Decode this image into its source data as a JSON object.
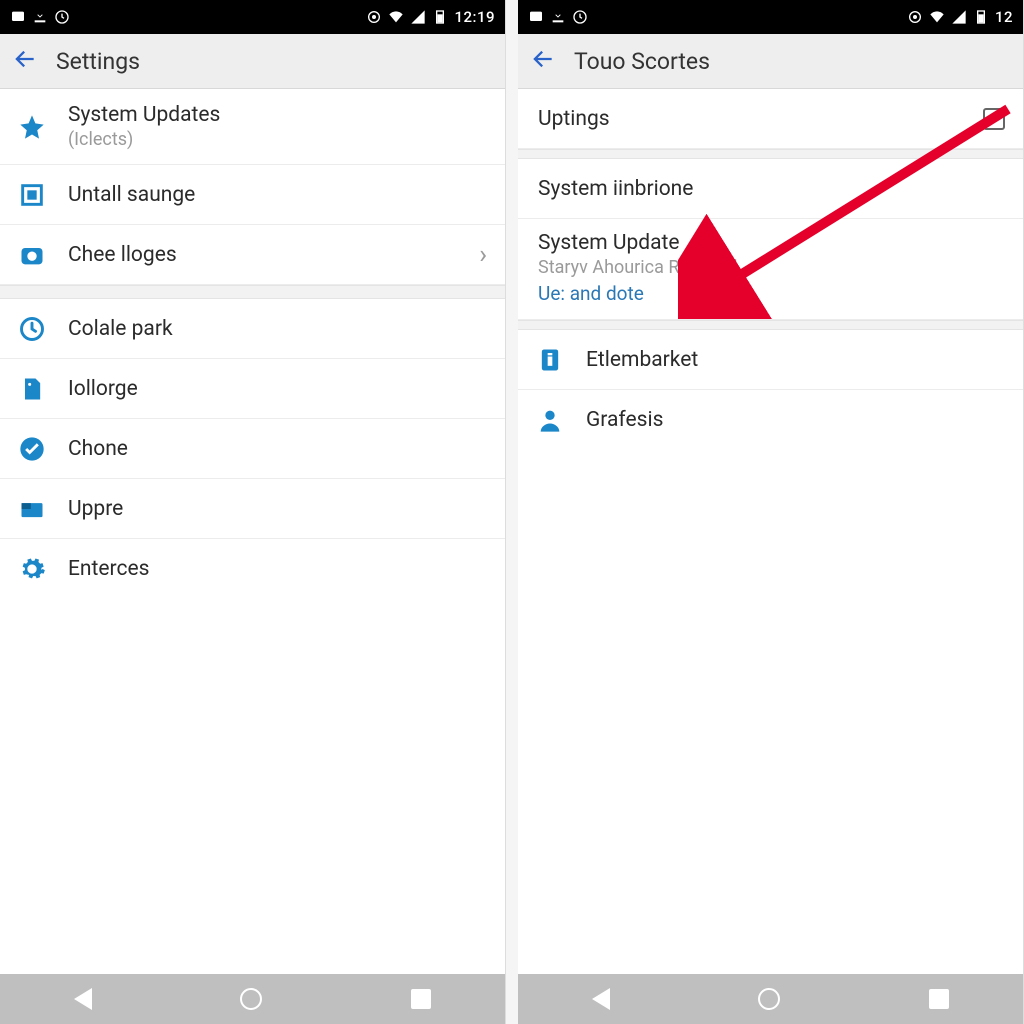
{
  "status": {
    "time": "12:19",
    "time_right": "12"
  },
  "left": {
    "title": "Settings",
    "rows": [
      {
        "icon": "star",
        "label": "System Updates",
        "sub": "(Iclects)"
      },
      {
        "icon": "square",
        "label": "Untall saunge"
      },
      {
        "icon": "camera",
        "label": "Chee lloges",
        "chevron": true
      },
      {
        "gap": true
      },
      {
        "icon": "clock",
        "label": "Colale park"
      },
      {
        "icon": "storage",
        "label": "Iollorge"
      },
      {
        "icon": "check",
        "label": "Chone"
      },
      {
        "icon": "card",
        "label": "Uppre"
      },
      {
        "icon": "gear",
        "label": "Enterces",
        "noBorder": true
      }
    ]
  },
  "right": {
    "title": "Touo Scortes",
    "rows": [
      {
        "plain": true,
        "label": "Uptings",
        "checkbox": true
      },
      {
        "gap": true,
        "small": true
      },
      {
        "plain": true,
        "label": "System iinbrione"
      },
      {
        "plain": true,
        "label": "System Update",
        "sub": "Staryv Ahourica Ristailad",
        "link": "Ue: and dote"
      },
      {
        "gap": true,
        "small": true
      },
      {
        "icon": "info",
        "label": "Etlembarket"
      },
      {
        "icon": "person",
        "label": "Grafesis",
        "noBorder": true
      }
    ]
  },
  "colors": {
    "accent": "#1b86c8",
    "arrow": "#e4002b"
  }
}
